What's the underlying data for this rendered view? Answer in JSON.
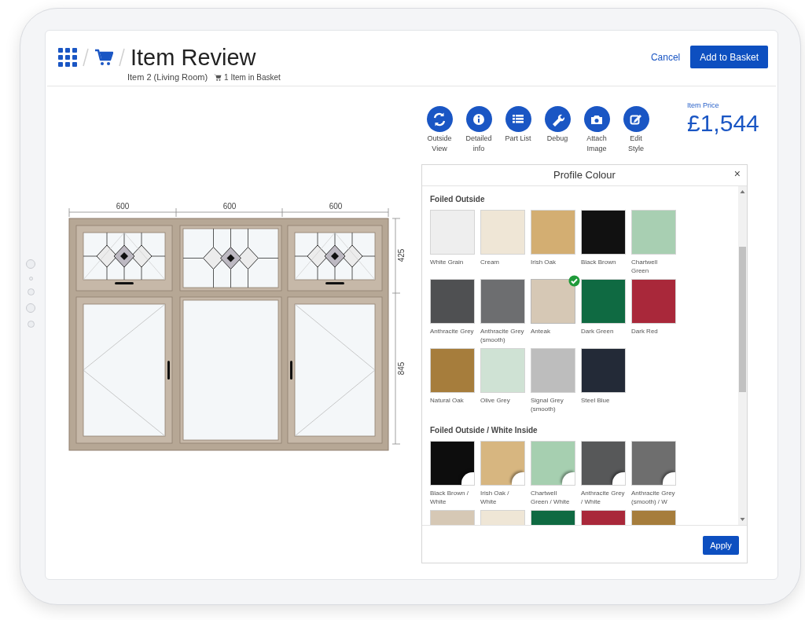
{
  "header": {
    "title": "Item Review",
    "subtitle": "Item 2 (Living Room)",
    "basket": "1 Item in Basket",
    "cancel": "Cancel",
    "add": "Add to Basket"
  },
  "actions": [
    {
      "kind": "refresh",
      "label": "Outside\nView"
    },
    {
      "kind": "info",
      "label": "Detailed\ninfo"
    },
    {
      "kind": "list",
      "label": "Part List"
    },
    {
      "kind": "wrench",
      "label": "Debug"
    },
    {
      "kind": "camera",
      "label": "Attach\nImage"
    },
    {
      "kind": "edit",
      "label": "Edit\nStyle"
    }
  ],
  "price": {
    "label": "Item Price",
    "value": "£1,544"
  },
  "drawing": {
    "widths": [
      "600",
      "600",
      "600"
    ],
    "heights": [
      "425",
      "845"
    ]
  },
  "panel": {
    "title": "Profile Colour",
    "close": "×",
    "apply": "Apply",
    "sections": [
      {
        "heading": "Foiled Outside",
        "kind": "plain",
        "swatches": [
          {
            "label": "White Grain",
            "color": "#eeeeee",
            "selected": false
          },
          {
            "label": "Cream",
            "color": "#efe6d6",
            "selected": false
          },
          {
            "label": "Irish Oak",
            "color": "#d3ae72",
            "selected": false
          },
          {
            "label": "Black Brown",
            "color": "#111111",
            "selected": false
          },
          {
            "label": "Chartwell Green",
            "color": "#a8cfb2",
            "selected": false
          },
          {
            "label": "Anthracite Grey",
            "color": "#4f5052",
            "selected": false
          },
          {
            "label": "Anthracite Grey (smooth)",
            "color": "#6d6e70",
            "selected": false
          },
          {
            "label": "Anteak",
            "color": "#d6c8b5",
            "selected": true
          },
          {
            "label": "Dark Green",
            "color": "#0f6a42",
            "selected": false
          },
          {
            "label": "Dark Red",
            "color": "#a9283a",
            "selected": false
          },
          {
            "label": "Natural Oak",
            "color": "#a67d3c",
            "selected": false
          },
          {
            "label": "Olive Grey",
            "color": "#cfe2d4",
            "selected": false
          },
          {
            "label": "Signal Grey (smooth)",
            "color": "#bdbdbd",
            "selected": false
          },
          {
            "label": "Steel Blue",
            "color": "#232a37",
            "selected": false
          }
        ]
      },
      {
        "heading": "Foiled Outside / White Inside",
        "kind": "white-inside",
        "swatches": [
          {
            "label": "Black Brown / White",
            "color": "#0d0d0d",
            "selected": false
          },
          {
            "label": "Irish Oak / White",
            "color": "#d7b680",
            "selected": false
          },
          {
            "label": "Chartwell Green / White",
            "color": "#a6cfb0",
            "selected": false
          },
          {
            "label": "Anthracite Grey / White",
            "color": "#575859",
            "selected": false
          },
          {
            "label": "Anthracite Grey (smooth) / W",
            "color": "#6e6e6e",
            "selected": false
          },
          {
            "color": "#d6c8b5",
            "selected": false
          },
          {
            "color": "#efe6d6",
            "selected": false
          },
          {
            "color": "#0f6a42",
            "selected": false
          },
          {
            "color": "#a9283a",
            "selected": false
          },
          {
            "color": "#a67d3c",
            "selected": false
          }
        ]
      }
    ]
  }
}
